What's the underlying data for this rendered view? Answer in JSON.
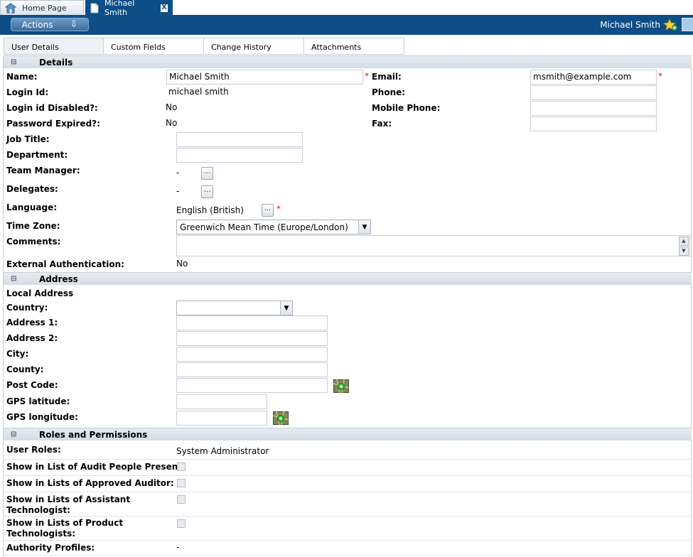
{
  "tabs": {
    "home": "Home Page",
    "active": "Michael Smith",
    "close_glyph": "X"
  },
  "toolbar": {
    "actions_label": "Actions",
    "user_name": "Michael Smith"
  },
  "subtabs": [
    "User Details",
    "Custom Fields",
    "Change History",
    "Attachments"
  ],
  "details": {
    "header": "Details",
    "name_label": "Name:",
    "name_value": "Michael Smith",
    "email_label": "Email:",
    "email_value": "msmith@example.com",
    "login_label": "Login Id:",
    "login_value": "michael smith",
    "phone_label": "Phone:",
    "login_disabled_label": "Login id Disabled?:",
    "login_disabled_value": "No",
    "mobile_label": "Mobile Phone:",
    "pw_expired_label": "Password Expired?:",
    "pw_expired_value": "No",
    "fax_label": "Fax:",
    "job_title_label": "Job Title:",
    "department_label": "Department:",
    "team_manager_label": "Team Manager:",
    "team_manager_value": "-",
    "delegates_label": "Delegates:",
    "delegates_value": "-",
    "language_label": "Language:",
    "language_value": "English (British)",
    "timezone_label": "Time Zone:",
    "timezone_value": "Greenwich Mean Time (Europe/London)",
    "comments_label": "Comments:",
    "ext_auth_label": "External Authentication:",
    "ext_auth_value": "No",
    "dots": "...",
    "required": "*"
  },
  "address": {
    "header": "Address",
    "local_label": "Local Address",
    "country_label": "Country:",
    "address1_label": "Address 1:",
    "address2_label": "Address 2:",
    "city_label": "City:",
    "county_label": "County:",
    "postcode_label": "Post Code:",
    "gps_lat_label": "GPS latitude:",
    "gps_lon_label": "GPS longitude:"
  },
  "roles": {
    "header": "Roles and Permissions",
    "user_roles_label": "User Roles:",
    "user_roles_value": "System Administrator",
    "audit_people_label": "Show in List of Audit People Present:",
    "approved_auditor_label": "Show in Lists of Approved Auditor:",
    "assistant_tech_label_1": "Show in Lists of Assistant",
    "assistant_tech_label_2": "Technologist:",
    "product_tech_label_1": "Show in Lists of Product",
    "product_tech_label_2": "Technologists:",
    "authority_label": "Authority Profiles:",
    "authority_value": "-"
  },
  "colors": {
    "brand_blue": "#0e4d86",
    "required_red": "#d2202a",
    "section_bg": "#dde4eb"
  }
}
